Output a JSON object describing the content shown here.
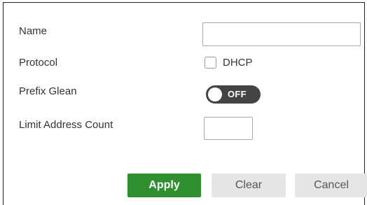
{
  "form": {
    "name_label": "Name",
    "name_value": "",
    "protocol_label": "Protocol",
    "dhcp_label": "DHCP",
    "dhcp_checked": false,
    "prefix_glean_label": "Prefix Glean",
    "prefix_glean_state": "OFF",
    "limit_label": "Limit Address Count",
    "limit_value": ""
  },
  "buttons": {
    "apply": "Apply",
    "clear": "Clear",
    "cancel": "Cancel"
  },
  "colors": {
    "apply_bg": "#2f8f2f",
    "secondary_bg": "#e6e6e6",
    "toggle_bg": "#444444"
  }
}
